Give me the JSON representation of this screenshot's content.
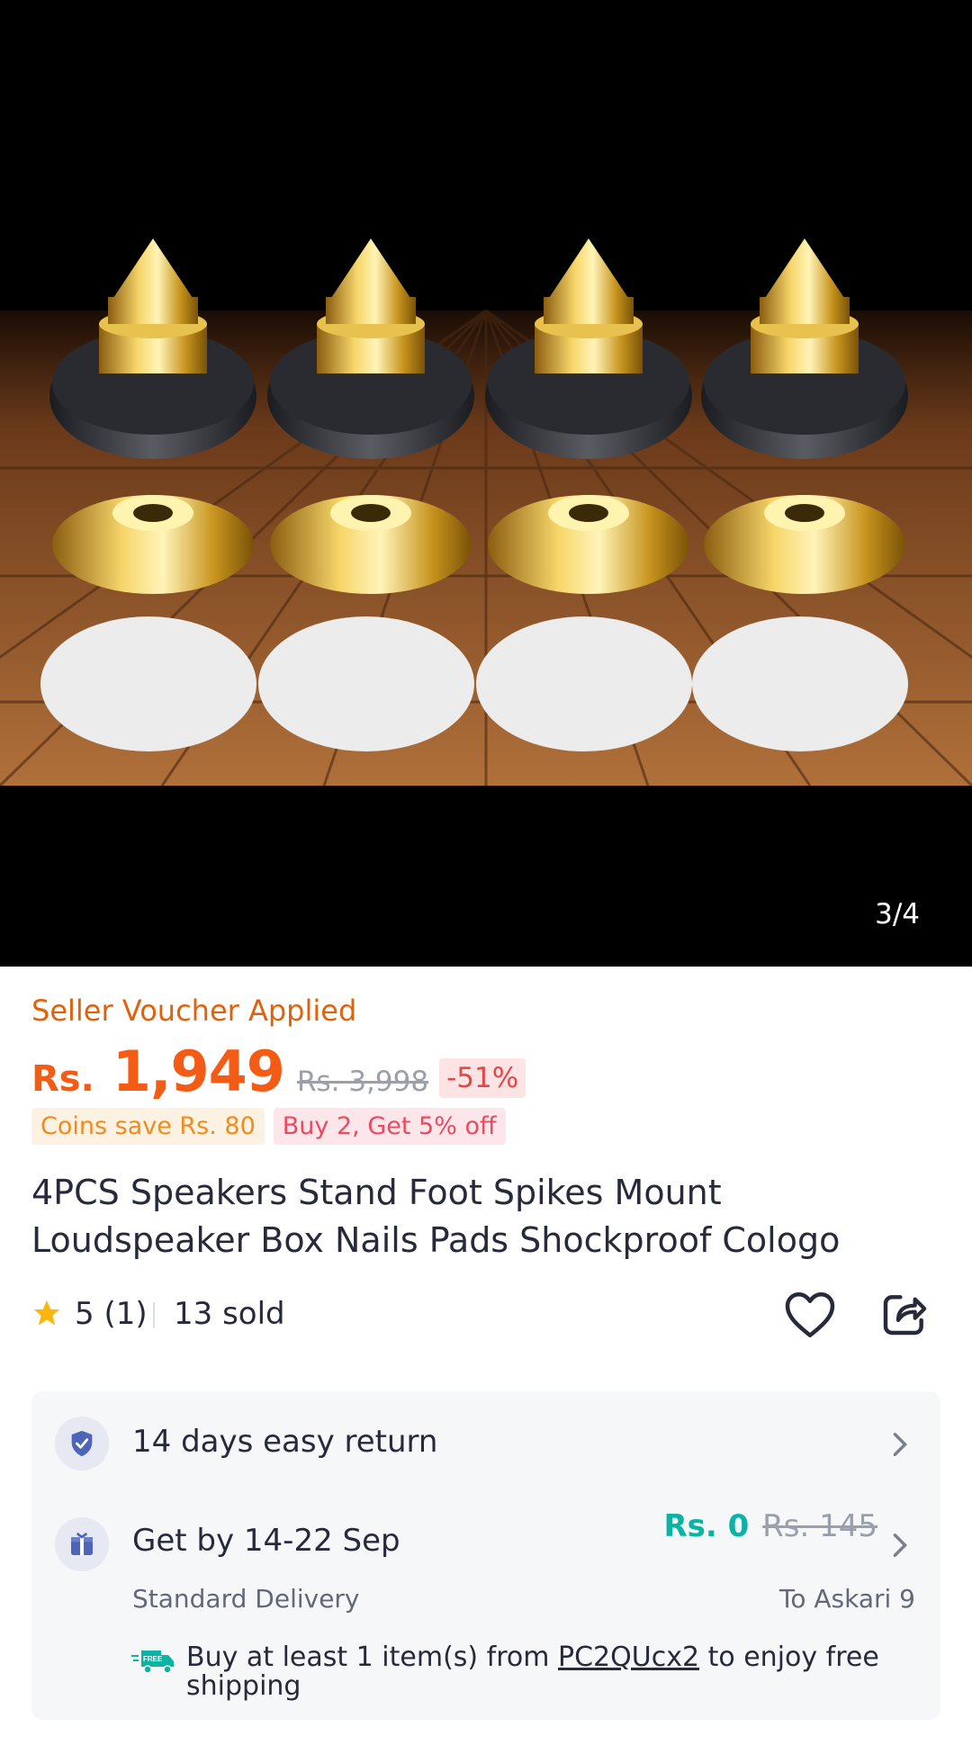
{
  "gallery": {
    "counter": "3/4",
    "image_alt": "4 sets of gold speaker spikes with bases and pads on wooden floor"
  },
  "pricing": {
    "voucher_label": "Seller Voucher Applied",
    "currency": "Rs.",
    "price": "1,949",
    "original_price": "Rs. 3,998",
    "discount": "-51%",
    "coins_chip": "Coins save Rs. 80",
    "promo_chip": "Buy 2, Get 5% off"
  },
  "product": {
    "title": "4PCS Speakers Stand Foot Spikes Mount Loudspeaker Box Nails Pads Shockproof Cologo",
    "rating": "5",
    "rating_count": "(1)",
    "sold": "13 sold"
  },
  "service": {
    "return_label": "14 days easy return",
    "delivery_label": "Get by 14-22 Sep",
    "delivery_fee": "Rs. 0",
    "delivery_fee_original": "Rs. 145",
    "delivery_type": "Standard Delivery",
    "destination": "To Askari 9",
    "free_shipping_prefix": "Buy at least 1 item(s) from ",
    "free_shipping_store": "PC2QUcx2",
    "free_shipping_suffix": " to enjoy free shipping",
    "truck_badge": "FREE"
  },
  "colors": {
    "price": "#f45c16",
    "voucher": "#e2620b",
    "free_fee": "#0ab3a4",
    "shield": "#4d64b7"
  }
}
